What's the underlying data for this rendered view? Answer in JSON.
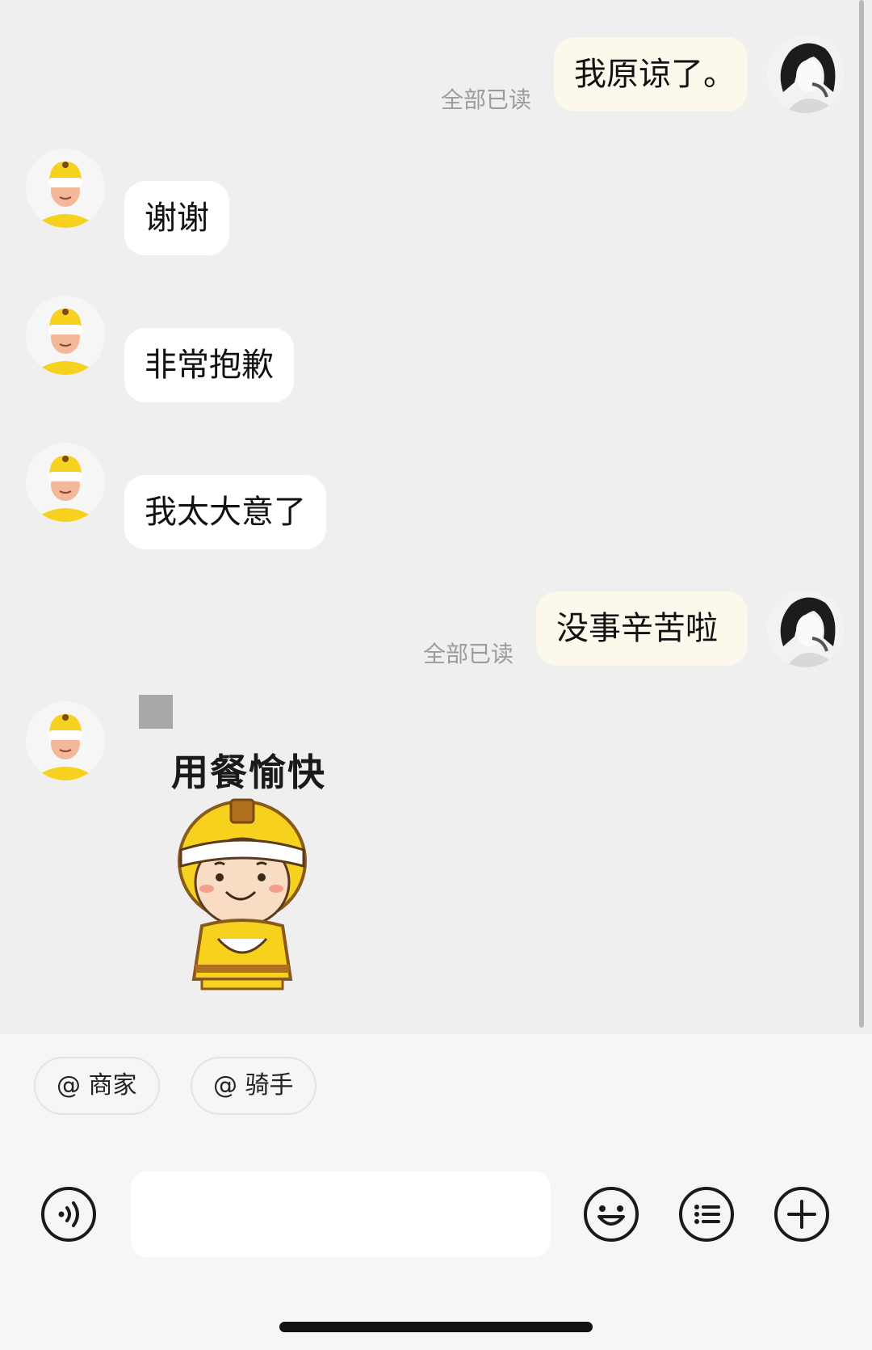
{
  "messages": [
    {
      "side": "out",
      "text": "我原谅了。",
      "status": "全部已读"
    },
    {
      "side": "in",
      "text": "谢谢"
    },
    {
      "side": "in",
      "text": "非常抱歉"
    },
    {
      "side": "in",
      "text": "我太大意了"
    },
    {
      "side": "out",
      "text": "没事辛苦啦",
      "status": "全部已读"
    },
    {
      "side": "in",
      "sticker": "用餐愉快"
    }
  ],
  "quick_mentions": [
    "@ 商家",
    "@ 骑手"
  ],
  "input": {
    "value": "",
    "placeholder": ""
  },
  "toolbar_icons": [
    "voice-icon",
    "emoji-icon",
    "quick-reply-icon",
    "plus-icon"
  ],
  "colors": {
    "background": "#efefef",
    "incoming_bubble": "#ffffff",
    "outgoing_bubble": "#fcf9ec",
    "rider_yellow": "#f6d21e",
    "status_text": "#9c9c9c"
  }
}
